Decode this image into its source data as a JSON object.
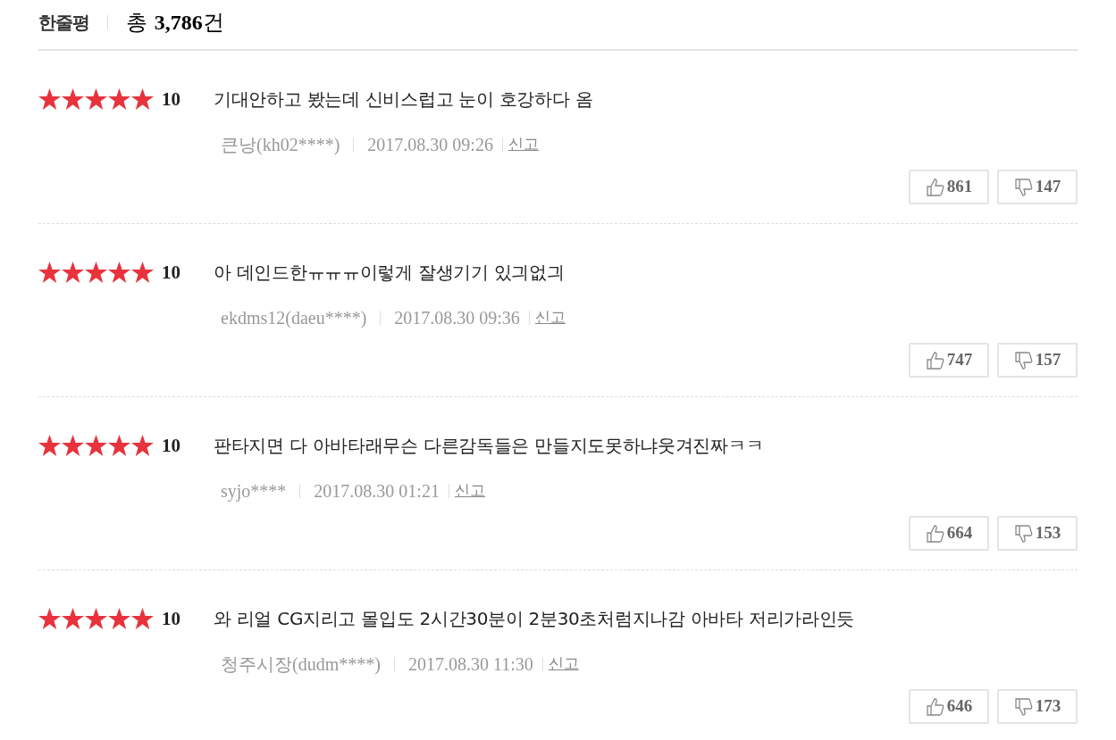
{
  "header": {
    "title": "한줄평",
    "total_prefix": "총",
    "total_count": "3,786",
    "total_suffix": "건"
  },
  "reviews": [
    {
      "stars": 5,
      "score": "10",
      "text": "기대안하고 봤는데 신비스럽고 눈이 호강하다 옴",
      "author": "큰낭(kh02****)",
      "date": "2017.08.30 09:26",
      "report": "신고",
      "likes": "861",
      "dislikes": "147"
    },
    {
      "stars": 5,
      "score": "10",
      "text": "아 데인드한ㅠㅠㅠ이렇게 잘생기기 있긔없긔",
      "author": "ekdms12(daeu****)",
      "date": "2017.08.30 09:36",
      "report": "신고",
      "likes": "747",
      "dislikes": "157"
    },
    {
      "stars": 5,
      "score": "10",
      "text": "판타지면 다 아바타래무슨 다른감독들은 만들지도못하냐웃겨진짜ㅋㅋ",
      "author": "syjo****",
      "date": "2017.08.30 01:21",
      "report": "신고",
      "likes": "664",
      "dislikes": "153"
    },
    {
      "stars": 5,
      "score": "10",
      "text": "와 리얼 CG지리고 몰입도 2시간30분이 2분30초처럼지나감 아바타 저리가라인듯",
      "author": "청주시장(dudm****)",
      "date": "2017.08.30 11:30",
      "report": "신고",
      "likes": "646",
      "dislikes": "173"
    }
  ]
}
